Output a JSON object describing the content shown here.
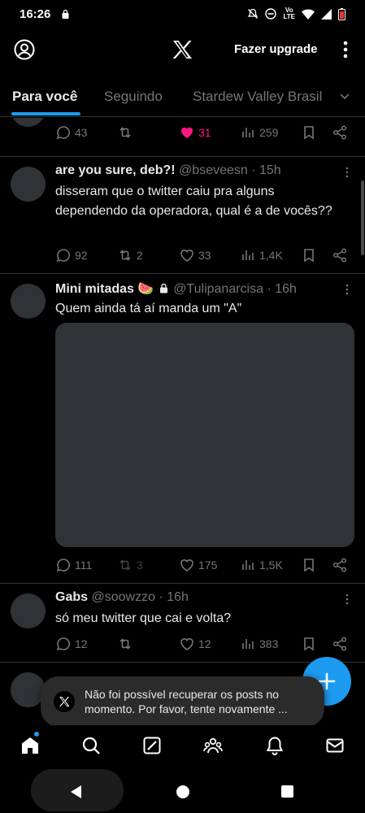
{
  "status_bar": {
    "time": "16:26",
    "network": "LTE",
    "icons": [
      "lock-icon",
      "mute-icon",
      "dnd-icon",
      "volte-icon",
      "wifi-icon",
      "signal-icon",
      "battery-icon"
    ]
  },
  "top_bar": {
    "upgrade_label": "Fazer upgrade",
    "icons": [
      "profile-icon",
      "x-logo-icon",
      "more-vertical-icon"
    ]
  },
  "tabs": [
    {
      "label": "Para você",
      "active": true
    },
    {
      "label": "Seguindo",
      "active": false
    },
    {
      "label": "Stardew Valley Brasil",
      "active": false
    }
  ],
  "posts": [
    {
      "partial": true,
      "stats": {
        "replies": "43",
        "reposts": "",
        "likes": "31",
        "views": "259",
        "liked": true
      }
    },
    {
      "name": "are you sure, deb?!",
      "handle": "@bseveesn",
      "time": "· 15h",
      "text": "disseram que o twitter caiu pra alguns dependendo da operadora, qual é a de vocês??",
      "stats": {
        "replies": "92",
        "reposts": "2",
        "likes": "33",
        "views": "1,4K"
      }
    },
    {
      "name": "Mini mitadas 🍉",
      "handle": "@Tulipanarcisa",
      "time": "· 16h",
      "text": "Quem ainda tá aí manda um \"A\"",
      "has_media": true,
      "protected": true,
      "stats": {
        "replies": "111",
        "reposts": "3",
        "likes": "175",
        "views": "1,5K"
      }
    },
    {
      "name": "Gabs",
      "handle": "@soowzzo",
      "time": "· 16h",
      "text": "só meu twitter que cai e volta?",
      "stats": {
        "replies": "12",
        "reposts": "",
        "likes": "12",
        "views": "383"
      }
    }
  ],
  "toast": {
    "message": "Não foi possível recuperar os posts no momento. Por favor, tente novamente ..."
  },
  "bottom_nav": [
    "home-icon",
    "search-icon",
    "grok-icon",
    "communities-icon",
    "notifications-icon",
    "messages-icon"
  ],
  "colors": {
    "accent": "#1d9bf0",
    "like": "#f91880",
    "muted": "#71767b",
    "background": "#000000"
  }
}
